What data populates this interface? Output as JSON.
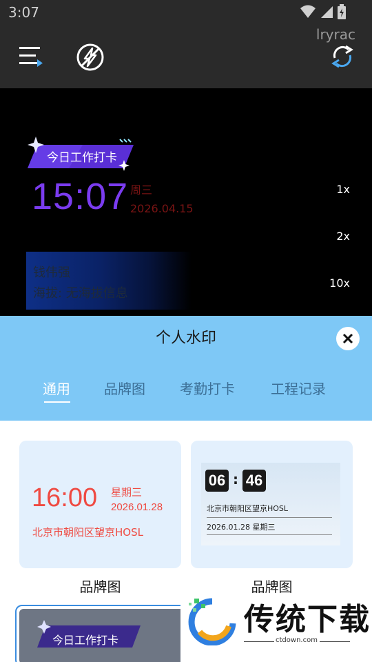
{
  "status_bar": {
    "time": "3:07"
  },
  "topbar": {
    "user_name": "lryrac"
  },
  "preview": {
    "punch_label": "今日工作打卡",
    "time": "15:07",
    "weekday": "周三",
    "date": "2026.04.15",
    "name_line": "钱伟强",
    "altitude_line": "海拔: 无海拔信息",
    "zoom_levels": [
      "1x",
      "2x",
      "10x"
    ]
  },
  "sheet": {
    "title": "个人水印",
    "tabs": [
      "通用",
      "品牌图",
      "考勤打卡",
      "工程记录"
    ],
    "active_tab": "通用"
  },
  "cards": [
    {
      "time": "16:00",
      "weekday": "星期三",
      "date": "2026.01.28",
      "location": "北京市朝阳区望京HOSL",
      "label": "品牌图"
    },
    {
      "hour": "06",
      "colon": ":",
      "minute": "46",
      "location": "北京市朝阳区望京HOSL",
      "date_week": "2026.01.28  星期三",
      "label": "品牌图"
    },
    {
      "punch_label": "今日工作打卡"
    }
  ],
  "watermark": {
    "site_name": "传统下载",
    "site_url": "ctdown.com"
  },
  "colors": {
    "sheet_header": "#7ec8f6",
    "preview_time": "#7b3cf0",
    "card_red": "#ef4a42",
    "selected_border": "#3a8de0"
  }
}
